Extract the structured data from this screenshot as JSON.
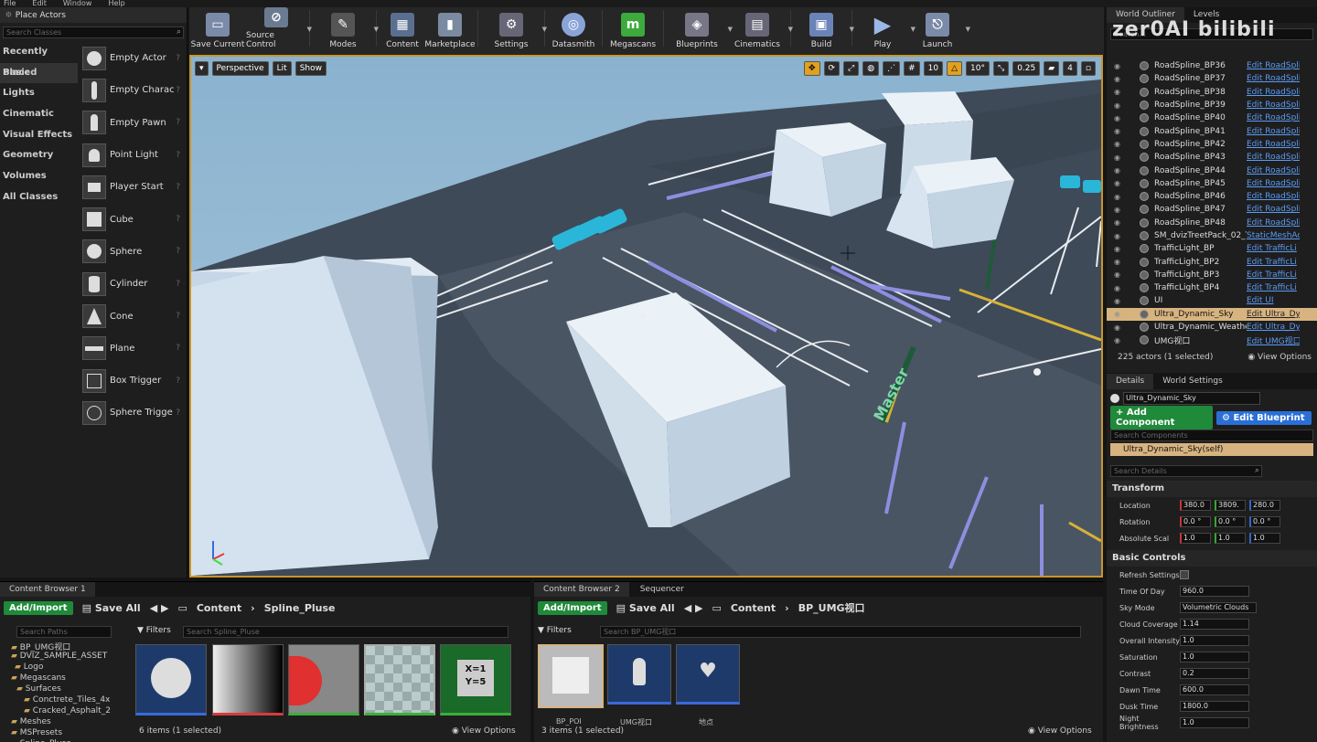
{
  "menu": [
    "File",
    "Edit",
    "Window",
    "Help"
  ],
  "place_actors": {
    "tab": "Place Actors",
    "search_placeholder": "Search Classes",
    "categories": [
      "Recently Placed",
      "Basic",
      "Lights",
      "Cinematic",
      "Visual Effects",
      "Geometry",
      "Volumes",
      "All Classes"
    ],
    "items": [
      "Empty Actor",
      "Empty Charac",
      "Empty Pawn",
      "Point Light",
      "Player Start",
      "Cube",
      "Sphere",
      "Cylinder",
      "Cone",
      "Plane",
      "Box Trigger",
      "Sphere Trigge"
    ]
  },
  "toolbar": [
    "Save Current",
    "Source Control",
    "Modes",
    "Content",
    "Marketplace",
    "Settings",
    "Datasmith",
    "Megascans",
    "Blueprints",
    "Cinematics",
    "Build",
    "Play",
    "Launch"
  ],
  "viewport": {
    "perspective": "Perspective",
    "lit": "Lit",
    "show": "Show",
    "grid": "10",
    "angle": "10°",
    "scale": "0.25",
    "speed": "4",
    "sign": "Master"
  },
  "outliner": {
    "tabs": [
      "World Outliner",
      "Levels"
    ],
    "search_placeholder": "Search...",
    "rows": [
      {
        "name": "RoadSpline_BP36",
        "link": "Edit RoadSpli"
      },
      {
        "name": "RoadSpline_BP37",
        "link": "Edit RoadSpli"
      },
      {
        "name": "RoadSpline_BP38",
        "link": "Edit RoadSpli"
      },
      {
        "name": "RoadSpline_BP39",
        "link": "Edit RoadSpli"
      },
      {
        "name": "RoadSpline_BP40",
        "link": "Edit RoadSpli"
      },
      {
        "name": "RoadSpline_BP41",
        "link": "Edit RoadSpli"
      },
      {
        "name": "RoadSpline_BP42",
        "link": "Edit RoadSpli"
      },
      {
        "name": "RoadSpline_BP43",
        "link": "Edit RoadSpli"
      },
      {
        "name": "RoadSpline_BP44",
        "link": "Edit RoadSpli"
      },
      {
        "name": "RoadSpline_BP45",
        "link": "Edit RoadSpli"
      },
      {
        "name": "RoadSpline_BP46",
        "link": "Edit RoadSpli"
      },
      {
        "name": "RoadSpline_BP47",
        "link": "Edit RoadSpli"
      },
      {
        "name": "RoadSpline_BP48",
        "link": "Edit RoadSpli"
      },
      {
        "name": "SM_dvizTreetPack_02_Tr",
        "link": "StaticMeshAc"
      },
      {
        "name": "TrafficLight_BP",
        "link": "Edit TrafficLi"
      },
      {
        "name": "TrafficLight_BP2",
        "link": "Edit TrafficLi"
      },
      {
        "name": "TrafficLight_BP3",
        "link": "Edit TrafficLi"
      },
      {
        "name": "TrafficLight_BP4",
        "link": "Edit TrafficLi"
      },
      {
        "name": "UI",
        "link": "Edit UI"
      },
      {
        "name": "Ultra_Dynamic_Sky",
        "link": "Edit Ultra_Dy"
      },
      {
        "name": "Ultra_Dynamic_Weather",
        "link": "Edit Ultra_Dy"
      },
      {
        "name": "UMG视口",
        "link": "Edit UMG视口"
      }
    ],
    "selected_index": 19,
    "count": "225 actors (1 selected)",
    "view_options": "View Options"
  },
  "details": {
    "tabs": [
      "Details",
      "World Settings"
    ],
    "object_name": "Ultra_Dynamic_Sky",
    "add_component": "+ Add Component",
    "edit_blueprint": "Edit Blueprint",
    "search_components": "Search Components",
    "self_component": "Ultra_Dynamic_Sky(self)",
    "search_details": "Search Details",
    "transform_header": "Transform",
    "location_label": "Location",
    "location": [
      "380.0",
      "3809.",
      "280.0"
    ],
    "rotation_label": "Rotation",
    "rotation": [
      "0.0 °",
      "0.0 °",
      "0.0 °"
    ],
    "scale_label": "Absolute Scal",
    "scale": [
      "1.0",
      "1.0",
      "1.0"
    ],
    "basic_header": "Basic Controls",
    "fields": [
      {
        "label": "Refresh Settings",
        "value": ""
      },
      {
        "label": "Time Of Day",
        "value": "960.0"
      },
      {
        "label": "Sky Mode",
        "value": "Volumetric Clouds"
      },
      {
        "label": "Cloud Coverage",
        "value": "1.14"
      },
      {
        "label": "Overall Intensity",
        "value": "1.0"
      },
      {
        "label": "Saturation",
        "value": "1.0"
      },
      {
        "label": "Contrast",
        "value": "0.2"
      },
      {
        "label": "Dawn Time",
        "value": "600.0"
      },
      {
        "label": "Dusk Time",
        "value": "1800.0"
      },
      {
        "label": "Night Brightness",
        "value": "1.0"
      }
    ]
  },
  "cb1": {
    "tab": "Content Browser 1",
    "add_import": "Add/Import",
    "save_all": "Save All",
    "path": [
      "Content",
      "Spline_Pluse"
    ],
    "search_paths": "Search Paths",
    "filters": "Filters",
    "search_assets": "Search Spline_Pluse",
    "folders": [
      "BP_UMG视口",
      "DVIZ_SAMPLE_ASSET",
      "Logo",
      "Megascans",
      "Surfaces",
      "Conctrete_Tiles_4x",
      "Cracked_Asphalt_2",
      "Meshes",
      "MSPresets",
      "Spline_Pluse"
    ],
    "count": "6 items (1 selected)",
    "view_options": "View Options",
    "xy_text": "X=1\nY=5"
  },
  "cb2": {
    "tabs": [
      "Content Browser 2",
      "Sequencer"
    ],
    "add_import": "Add/Import",
    "save_all": "Save All",
    "path": [
      "Content",
      "BP_UMG视口"
    ],
    "filters": "Filters",
    "search_assets": "Search BP_UMG视口",
    "asset_labels": [
      "BP_POI",
      "UMG视口",
      "地点"
    ],
    "count": "3 items (1 selected)",
    "view_options": "View Options"
  },
  "watermark": "zer0AI bilibili",
  "colors": {
    "accent": "#c7962a",
    "selection": "#d7b37f",
    "green": "#1f8a3a",
    "blue": "#2a6fd6",
    "link": "#5b9bf5"
  }
}
